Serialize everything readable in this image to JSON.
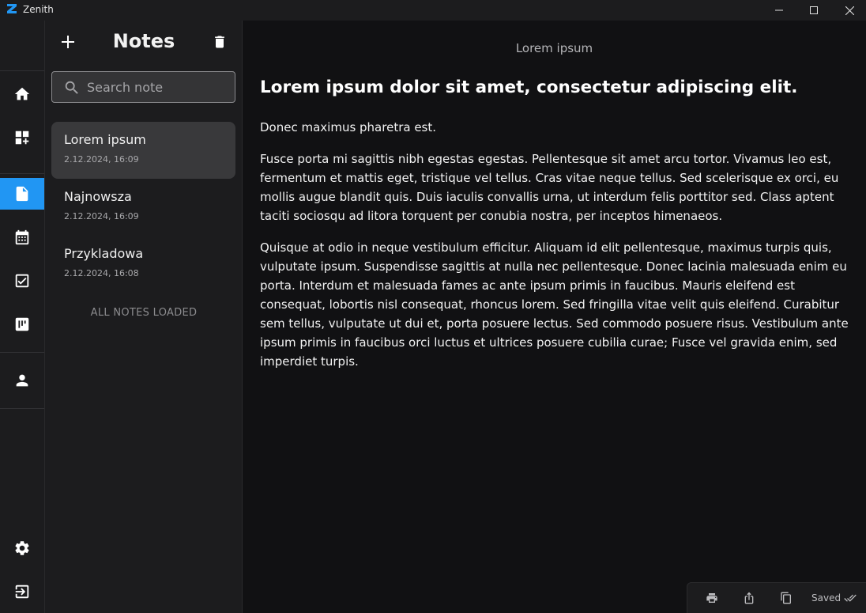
{
  "window": {
    "title": "Zenith",
    "logo_color": "#2196f3"
  },
  "rail": {
    "accent": "#2196f3",
    "items": [
      {
        "name": "home-icon",
        "active": false
      },
      {
        "name": "add-widget-icon",
        "active": false
      },
      {
        "name": "notes-icon",
        "active": true
      },
      {
        "name": "calendar-icon",
        "active": false
      },
      {
        "name": "checkbox-icon",
        "active": false
      },
      {
        "name": "kanban-icon",
        "active": false
      },
      {
        "name": "person-icon",
        "active": false
      },
      {
        "name": "settings-icon",
        "active": false
      },
      {
        "name": "logout-icon",
        "active": false
      }
    ]
  },
  "notes_panel": {
    "title": "Notes",
    "search_placeholder": "Search note",
    "notes": [
      {
        "title": "Lorem ipsum",
        "date": "2.12.2024, 16:09",
        "selected": true
      },
      {
        "title": "Najnowsza",
        "date": "2.12.2024, 16:09",
        "selected": false
      },
      {
        "title": "Przykladowa",
        "date": "2.12.2024, 16:08",
        "selected": false
      }
    ],
    "all_loaded_label": "ALL NOTES LOADED"
  },
  "editor": {
    "note_title": "Lorem ipsum",
    "heading": "Lorem ipsum dolor sit amet, consectetur adipiscing elit.",
    "paragraphs": [
      "Donec maximus pharetra est.",
      "Fusce porta mi sagittis nibh egestas egestas. Pellentesque sit amet arcu tortor. Vivamus leo est, fermentum et mattis eget, tristique vel tellus. Cras vitae neque tellus. Sed scelerisque ex orci, eu mollis augue blandit quis. Duis iaculis convallis urna, ut interdum felis porttitor sed. Class aptent taciti sociosqu ad litora torquent per conubia nostra, per inceptos himenaeos.",
      "Quisque at odio in neque vestibulum efficitur. Aliquam id elit pellentesque, maximus turpis quis, vulputate ipsum. Suspendisse sagittis at nulla nec pellentesque. Donec lacinia malesuada enim eu porta. Interdum et malesuada fames ac ante ipsum primis in faucibus. Mauris eleifend est consequat, lobortis nisl consequat, rhoncus lorem. Sed fringilla vitae velit quis eleifend. Curabitur sem tellus, vulputate ut dui et, porta posuere lectus. Sed commodo posuere risus. Vestibulum ante ipsum primis in faucibus orci luctus et ultrices posuere cubilia curae; Fusce vel gravida enim, sed imperdiet turpis."
    ],
    "status": "Saved"
  }
}
